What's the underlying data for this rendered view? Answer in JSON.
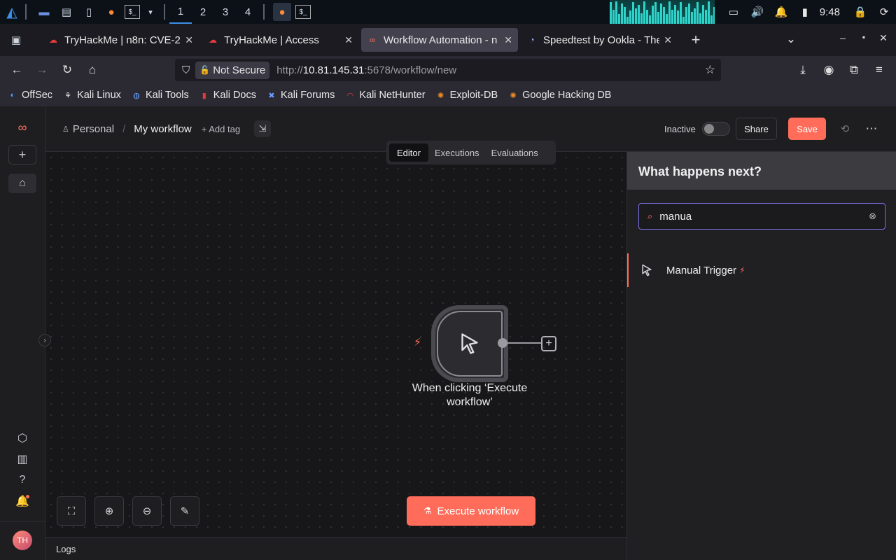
{
  "taskbar": {
    "workspaces": [
      "1",
      "2",
      "3",
      "4"
    ],
    "clock": "9:48",
    "equalizer_levels": [
      0.9,
      0.6,
      0.95,
      0.4,
      0.85,
      0.7,
      0.3,
      0.55,
      0.9,
      0.65,
      0.8,
      0.45,
      0.95,
      0.6,
      0.35,
      0.75,
      0.9,
      0.5,
      0.85,
      0.7,
      0.4,
      0.95,
      0.6,
      0.8,
      0.55,
      0.9,
      0.3,
      0.7,
      0.85,
      0.5,
      0.65,
      0.9,
      0.45,
      0.8,
      0.6,
      0.95,
      0.35,
      0.7
    ]
  },
  "browser": {
    "tabs": [
      {
        "title": "TryHackMe | n8n: CVE-20",
        "close": "✕"
      },
      {
        "title": "TryHackMe | Access",
        "close": "✕"
      },
      {
        "title": "Workflow Automation - n",
        "close": "✕"
      },
      {
        "title": "Speedtest by Ookla - The",
        "close": "✕"
      }
    ],
    "new_tab": "+",
    "security_label": "Not Secure",
    "url_prefix": "http://",
    "url_host": "10.81.145.31",
    "url_rest": ":5678/workflow/new",
    "bookmarks": [
      "OffSec",
      "Kali Linux",
      "Kali Tools",
      "Kali Docs",
      "Kali Forums",
      "Kali NetHunter",
      "Exploit-DB",
      "Google Hacking DB"
    ]
  },
  "header": {
    "project": "Personal",
    "separator": "/",
    "workflow_name": "My workflow",
    "add_tag": "+ Add tag",
    "status": "Inactive",
    "share": "Share",
    "save": "Save",
    "more": "⋯"
  },
  "view_tabs": [
    "Editor",
    "Executions",
    "Evaluations"
  ],
  "canvas": {
    "node_title": "When clicking ‘Execute workflow’",
    "execute_label": "Execute workflow"
  },
  "logs_label": "Logs",
  "panel": {
    "title": "What happens next?",
    "search_value": "manua",
    "results": [
      {
        "label": "Manual Trigger"
      }
    ]
  },
  "user_initials": "TH",
  "colors": {
    "accent": "#ff6d5a",
    "canvas_bg": "#171719"
  }
}
